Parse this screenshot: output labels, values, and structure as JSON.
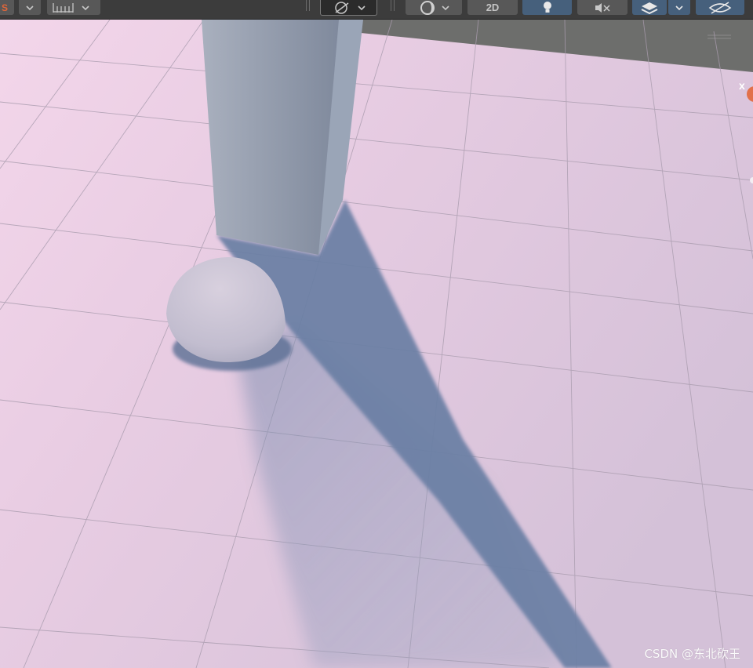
{
  "toolbar": {
    "mode_2d_label": "2D",
    "buttons": [
      {
        "icon": "shading-icon",
        "state": "collapsed"
      },
      {
        "icon": "grid-snap-icon",
        "state": "collapsed"
      },
      {
        "icon": "draw-mode-icon",
        "state": "selected"
      },
      {
        "icon": "render-mode-icon",
        "state": "collapsed"
      },
      {
        "icon": "lighting-icon",
        "state": "active"
      },
      {
        "icon": "audio-mute-icon",
        "state": "inactive"
      },
      {
        "icon": "layers-icon",
        "state": "active"
      },
      {
        "icon": "scene-visibility-icon",
        "state": "active"
      }
    ]
  },
  "scene": {
    "gizmo_axis_label": "x",
    "watermark": "CSDN @东北砍王",
    "colors": {
      "floor": "#dccadf",
      "shadow": "#6a7fa3",
      "box": "#8e98aa",
      "sphere": "#c9c2d3"
    }
  }
}
